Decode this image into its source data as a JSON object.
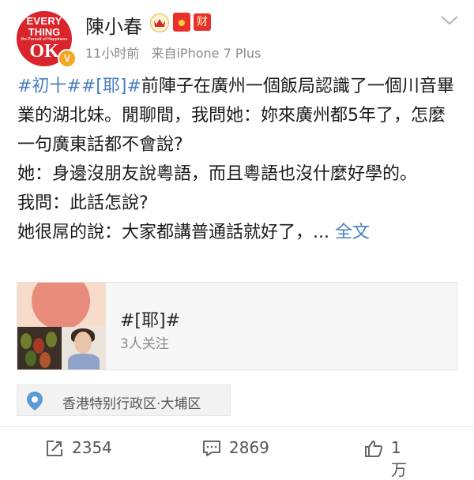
{
  "header": {
    "avatar_lines": [
      "EVERY",
      "THING",
      "the Pursuit of Happiness",
      "OK"
    ],
    "verified_badge": "V",
    "username": "陳小春",
    "badges": [
      "crown-icon",
      "red-envelope-icon"
    ],
    "cai_badge": "财",
    "time": "11小时前",
    "source": "来自iPhone 7 Plus",
    "menu_icon": "chevron-down-icon"
  },
  "post": {
    "tags": [
      "#初十#",
      "#[耶]#"
    ],
    "lines": [
      "前陣子在廣州一個飯局認識了一個川音畢業的湖北妹。閒聊間，我問她：妳來廣州都5年了，怎麼一句廣東話都不會說?",
      "她：身邊沒朋友說粵語，而且粵語也沒什麼好學的。",
      "我問：此話怎說?",
      "她很屌的說：大家都講普通話就好了，... "
    ],
    "full_text_link": "全文"
  },
  "topic_card": {
    "title": "#[耶]#",
    "followers": "3人关注"
  },
  "location": {
    "icon": "location-pin-icon",
    "text": "香港特别行政区·大埔区"
  },
  "actions": {
    "repost": {
      "icon": "repost-icon",
      "count": "2354"
    },
    "comment": {
      "icon": "comment-icon",
      "count": "2869"
    },
    "like": {
      "icon": "thumbs-up-icon",
      "count": "1万"
    }
  },
  "colors": {
    "link": "#4a7fbf",
    "meta": "#8a8a8a",
    "avatar_bg": "#d8242a"
  }
}
